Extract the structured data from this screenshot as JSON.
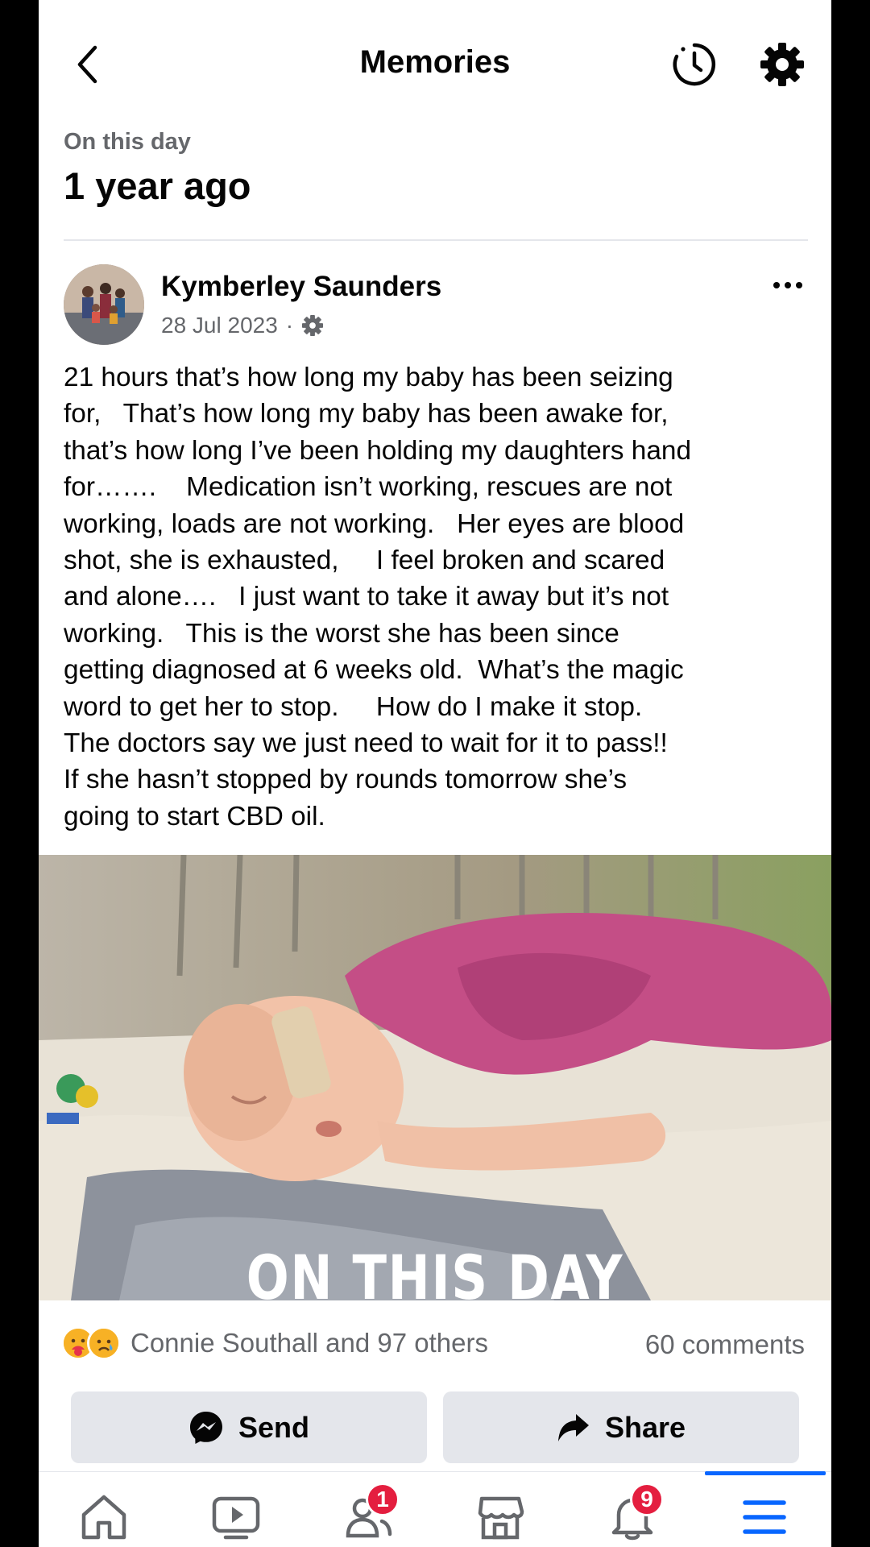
{
  "header": {
    "title": "Memories",
    "back_icon": "chevron-left-icon",
    "history_icon": "clock-history-icon",
    "settings_icon": "gear-icon"
  },
  "memory": {
    "section_label": "On this day",
    "years_ago": "1 year ago"
  },
  "post": {
    "author": "Kymberley Saunders",
    "date": "28 Jul 2023",
    "separator": "·",
    "audience_icon": "gear-icon",
    "text": "21 hours that’s how long my baby has been seizing\nfor,   That’s how long my baby has been awake for,\nthat’s how long I’ve been holding my daughters hand\nfor…….    Medication isn’t working, rescues are not\nworking, loads are not working.   Her eyes are blood\nshot, she is exhausted,     I feel broken and scared\nand alone….   I just want to take it away but it’s not\nworking.   This is the worst she has been since\ngetting diagnosed at 6 weeks old.  What’s the magic\nword to get her to stop.     How do I make it stop.\nThe doctors say we just need to wait for it to pass!!\nIf she hasn’t stopped by rounds tomorrow she’s\ngoing to start CBD oil.",
    "photo_caption": "ON THIS DAY",
    "reactions_text": "Connie Southall and 97 others",
    "comments_text": "60 comments"
  },
  "actions": {
    "send_label": "Send",
    "share_label": "Share"
  },
  "nav": {
    "items": [
      {
        "icon": "home-icon"
      },
      {
        "icon": "video-icon"
      },
      {
        "icon": "friends-icon",
        "badge": "1"
      },
      {
        "icon": "marketplace-icon"
      },
      {
        "icon": "bell-icon",
        "badge": "9"
      },
      {
        "icon": "menu-icon"
      }
    ]
  },
  "colors": {
    "accent": "#0866ff",
    "badge": "#e41e3f",
    "secondary_text": "#65676b",
    "button_bg": "#e4e6eb"
  }
}
